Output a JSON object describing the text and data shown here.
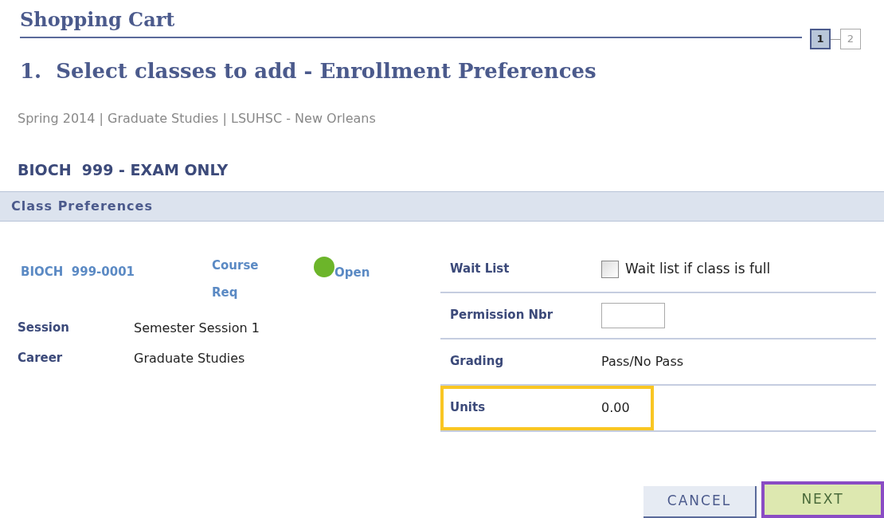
{
  "page_title": "Shopping Cart",
  "steps": [
    {
      "label": "1",
      "selected": true
    },
    {
      "label": "2",
      "selected": false
    }
  ],
  "heading": "1.  Select classes to add - Enrollment Preferences",
  "breadcrumb": "Spring 2014 | Graduate Studies | LSUHSC - New Orleans",
  "course_title": "BIOCH  999 - EXAM ONLY",
  "section_title": "Class Preferences",
  "class": {
    "number": "BIOCH  999-0001",
    "requirement": "Course Req",
    "status": "Open",
    "color": "#6cb52a"
  },
  "details": [
    {
      "label": "Session",
      "value": "Semester Session 1"
    },
    {
      "label": "Career",
      "value": "Graduate Studies"
    }
  ],
  "preferences": [
    {
      "kind": "checkbox",
      "label": "Wait List",
      "text": "Wait list if class is full",
      "checked": false,
      "highlighted": false
    },
    {
      "kind": "input",
      "label": "Permission Nbr",
      "highlighted": false
    },
    {
      "kind": "text",
      "label": "Grading",
      "value": "Pass/No Pass",
      "highlighted": false
    },
    {
      "kind": "text",
      "label": "Units",
      "value": "0.00",
      "highlighted": true
    }
  ],
  "buttons": [
    {
      "kind": "cancel",
      "label": "CANCEL",
      "highlighted": false
    },
    {
      "kind": "next",
      "label": "NEXT",
      "highlighted": true
    }
  ]
}
